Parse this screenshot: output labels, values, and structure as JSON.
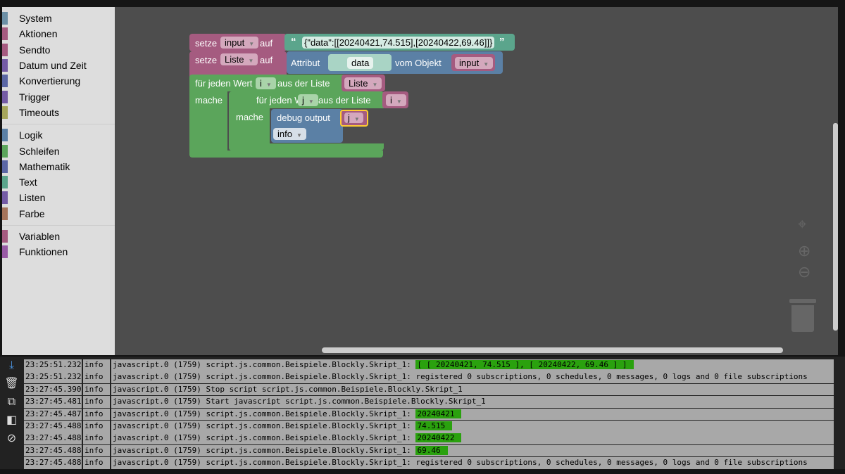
{
  "sidebar": {
    "groups": [
      [
        {
          "label": "System",
          "color": "#6c8fa5"
        },
        {
          "label": "Aktionen",
          "color": "#a55b80"
        },
        {
          "label": "Sendto",
          "color": "#a55b80"
        },
        {
          "label": "Datum und Zeit",
          "color": "#745ba5"
        },
        {
          "label": "Konvertierung",
          "color": "#5b67a5"
        },
        {
          "label": "Trigger",
          "color": "#745ba5"
        },
        {
          "label": "Timeouts",
          "color": "#a5a55b"
        }
      ],
      [
        {
          "label": "Logik",
          "color": "#5b80a5"
        },
        {
          "label": "Schleifen",
          "color": "#5ba55b"
        },
        {
          "label": "Mathematik",
          "color": "#5b67a5"
        },
        {
          "label": "Text",
          "color": "#5ba58c"
        },
        {
          "label": "Listen",
          "color": "#745ba5"
        },
        {
          "label": "Farbe",
          "color": "#a5745b"
        }
      ],
      [
        {
          "label": "Variablen",
          "color": "#a55b80"
        },
        {
          "label": "Funktionen",
          "color": "#995ba5"
        }
      ]
    ]
  },
  "blocks": {
    "set1": {
      "kw": "setze",
      "var": "input",
      "auf": "auf",
      "text": "{\"data\":[[20240421,74.515],[20240422,69.46]]}",
      "ql": "“",
      "qr": "”"
    },
    "set2": {
      "kw": "setze",
      "var": "Liste",
      "auf": "auf",
      "attr": "Attribut",
      "attr_text": "data",
      "obj": "vom Objekt",
      "obj_var": "input"
    },
    "loop1": {
      "label": "für jeden Wert",
      "var": "i",
      "from": "aus der Liste",
      "list": "Liste",
      "do": "mache"
    },
    "loop2": {
      "label": "für jeden Wert",
      "var": "j",
      "from": "aus der Liste",
      "list": "i",
      "do": "mache"
    },
    "debug": {
      "label": "debug output",
      "var": "j",
      "level": "info"
    }
  },
  "log": {
    "rows": [
      {
        "time": "23:25:51.232",
        "level": "info",
        "msg": "javascript.0 (1759) script.js.common.Beispiele.Blockly.Skript_1: ",
        "hl": "[ [ 20240421, 74.515 ], [ 20240422, 69.46 ] ]"
      },
      {
        "time": "23:25:51.232",
        "level": "info",
        "msg": "javascript.0 (1759) script.js.common.Beispiele.Blockly.Skript_1: registered 0 subscriptions, 0 schedules, 0 messages, 0 logs and 0 file subscriptions"
      },
      {
        "time": "23:27:45.390",
        "level": "info",
        "msg": "javascript.0 (1759) Stop script script.js.common.Beispiele.Blockly.Skript_1"
      },
      {
        "time": "23:27:45.481",
        "level": "info",
        "msg": "javascript.0 (1759) Start javascript script.js.common.Beispiele.Blockly.Skript_1"
      },
      {
        "time": "23:27:45.487",
        "level": "info",
        "msg": "javascript.0 (1759) script.js.common.Beispiele.Blockly.Skript_1: ",
        "hl": "20240421"
      },
      {
        "time": "23:27:45.488",
        "level": "info",
        "msg": "javascript.0 (1759) script.js.common.Beispiele.Blockly.Skript_1: ",
        "hl": "74.515"
      },
      {
        "time": "23:27:45.488",
        "level": "info",
        "msg": "javascript.0 (1759) script.js.common.Beispiele.Blockly.Skript_1: ",
        "hl": "20240422"
      },
      {
        "time": "23:27:45.488",
        "level": "info",
        "msg": "javascript.0 (1759) script.js.common.Beispiele.Blockly.Skript_1: ",
        "hl": "69.46"
      },
      {
        "time": "23:27:45.488",
        "level": "info",
        "msg": "javascript.0 (1759) script.js.common.Beispiele.Blockly.Skript_1: registered 0 subscriptions, 0 schedules, 0 messages, 0 logs and 0 file subscriptions"
      }
    ]
  },
  "icons": {
    "log": [
      "scroll-down-icon",
      "clear-log-icon",
      "copy-icon",
      "columns-icon",
      "hide-icon"
    ],
    "workspace": [
      "center-icon",
      "zoom-in-icon",
      "zoom-out-icon",
      "trash-icon"
    ]
  }
}
